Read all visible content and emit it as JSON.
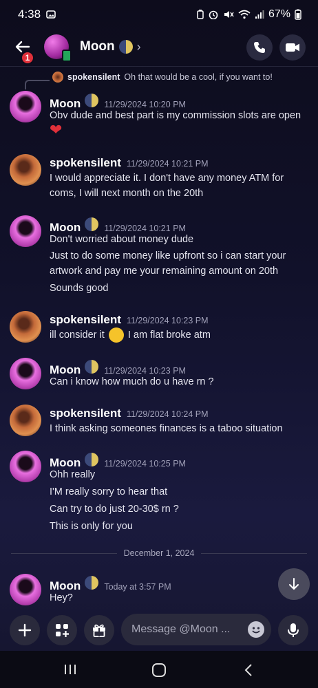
{
  "status_bar": {
    "time": "4:38",
    "battery": "67%"
  },
  "header": {
    "back_badge": "1",
    "name": "Moon",
    "chevron": "›"
  },
  "reply": {
    "author": "spokensilent",
    "text": "Oh that would be a cool, if you want to!"
  },
  "messages": [
    {
      "author": "Moon",
      "time": "11/29/2024 10:20 PM",
      "lines": [
        "Obv dude and best part is my commission slots are open"
      ]
    },
    {
      "author": "spokensilent",
      "time": "11/29/2024 10:21 PM",
      "lines": [
        "I would appreciate it. I don't have any money ATM for coms, I will next month on the 20th"
      ]
    },
    {
      "author": "Moon",
      "time": "11/29/2024 10:21 PM",
      "lines": [
        "Don't worried about money dude",
        "Just to do some money like upfront so i can start your artwork and pay me your remaining amount on 20th",
        "Sounds good"
      ]
    },
    {
      "author": "spokensilent",
      "time": "11/29/2024 10:23 PM",
      "lines": [
        "ill consider it",
        "I am flat broke atm"
      ]
    },
    {
      "author": "Moon",
      "time": "11/29/2024 10:23 PM",
      "lines": [
        "Can i know how much do u have rn ?"
      ]
    },
    {
      "author": "spokensilent",
      "time": "11/29/2024 10:24 PM",
      "lines": [
        "I think asking someones finances is a taboo situation"
      ]
    },
    {
      "author": "Moon",
      "time": "11/29/2024 10:25 PM",
      "lines": [
        "Ohh really",
        "I'M really sorry to hear that",
        "Can try to  do just  20-30$ rn ?",
        "This is only for you"
      ]
    },
    {
      "author": "Moon",
      "time": "Today at 3:57 PM",
      "lines": [
        "Hey?"
      ]
    }
  ],
  "date_separator": "December 1, 2024",
  "composer": {
    "placeholder": "Message @Moon ..."
  },
  "colors": {
    "accent_red": "#e0303a",
    "online_green": "#23a55a"
  }
}
